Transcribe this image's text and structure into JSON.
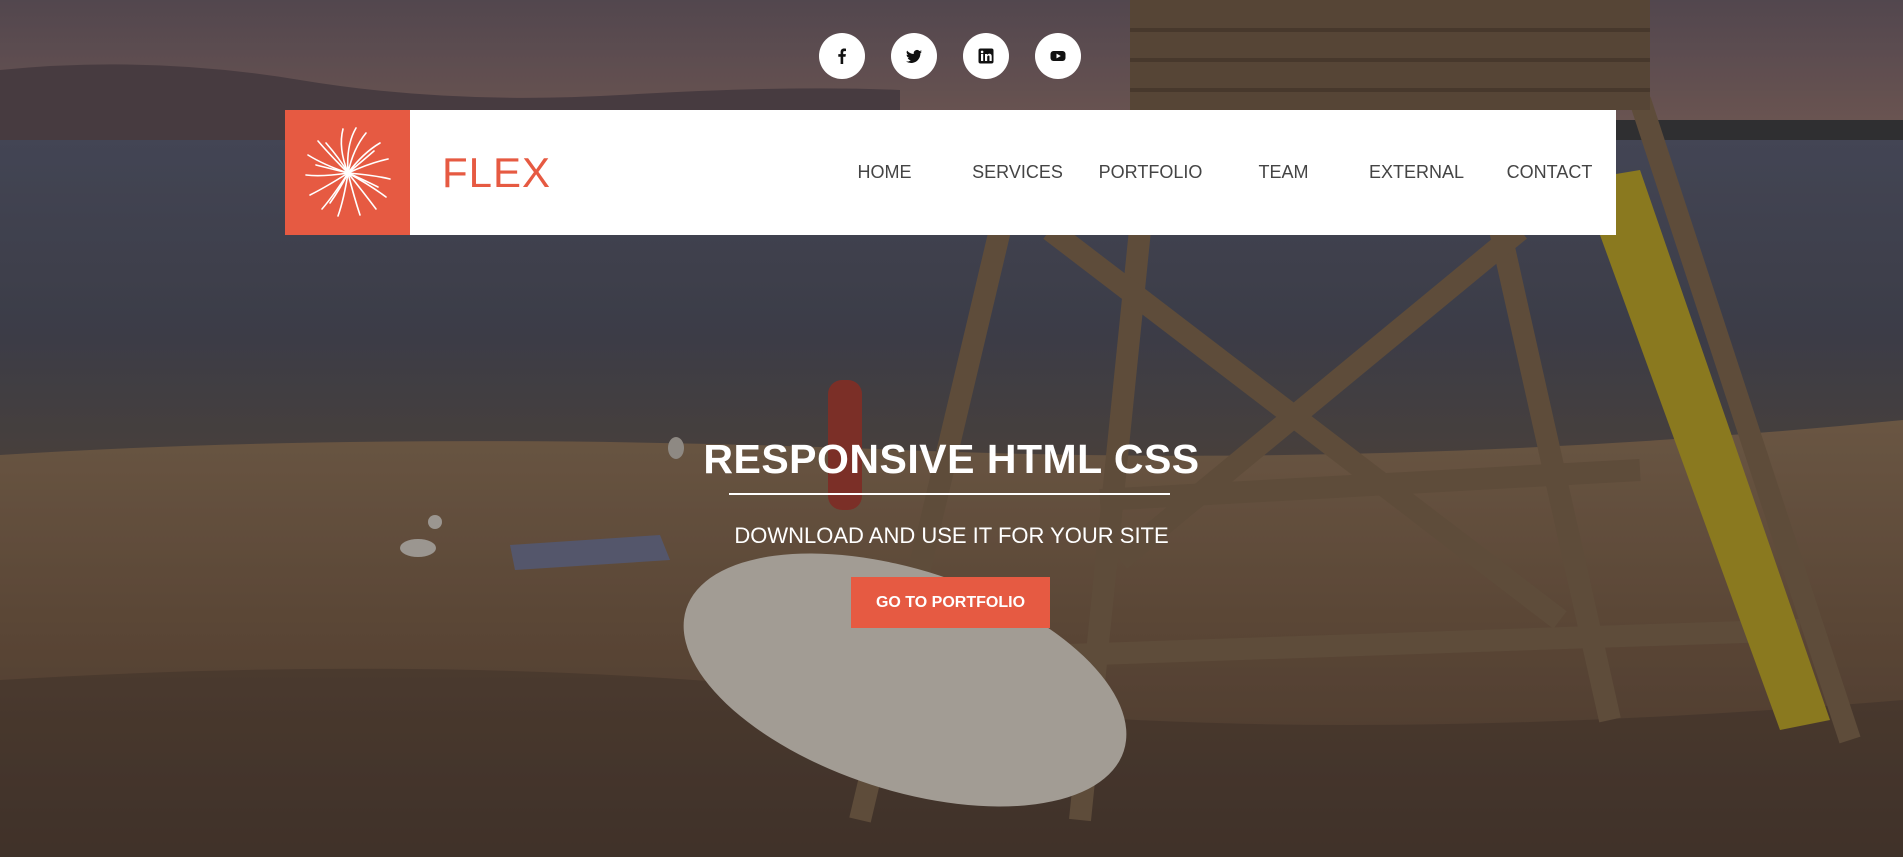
{
  "social": [
    {
      "icon": "facebook-icon",
      "label": "f"
    },
    {
      "icon": "twitter-icon",
      "label": ""
    },
    {
      "icon": "linkedin-icon",
      "label": "in"
    },
    {
      "icon": "youtube-icon",
      "label": ""
    }
  ],
  "brand": {
    "name": "FLEX",
    "logo_icon": "starburst-logo-icon"
  },
  "nav": {
    "items": [
      "HOME",
      "SERVICES",
      "PORTFOLIO",
      "TEAM",
      "EXTERNAL",
      "CONTACT"
    ]
  },
  "hero": {
    "title": "RESPONSIVE HTML CSS",
    "subtitle": "DOWNLOAD AND USE IT FOR YOUR SITE",
    "cta_label": "GO TO PORTFOLIO"
  },
  "colors": {
    "accent": "#e65a42",
    "nav_text": "#444444",
    "nav_bg": "#ffffff",
    "hero_text": "#ffffff"
  }
}
